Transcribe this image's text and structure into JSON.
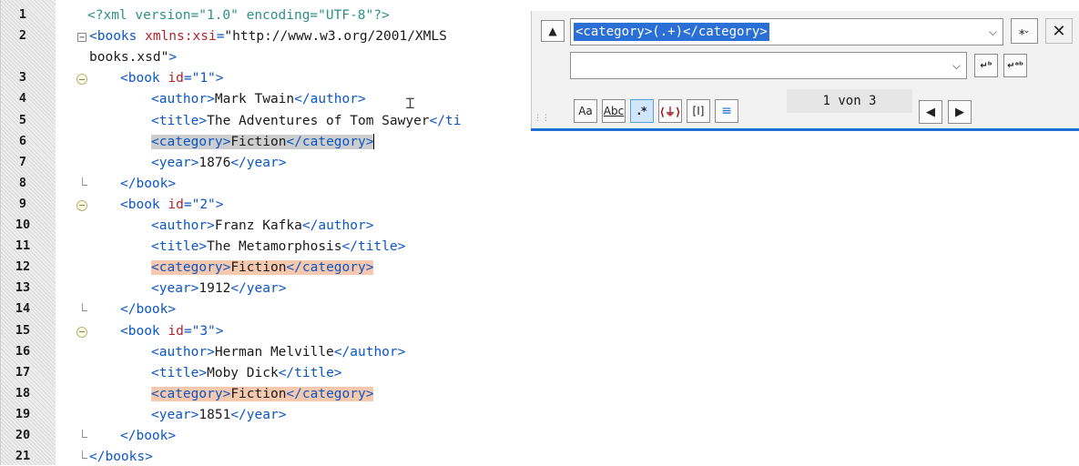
{
  "editor": {
    "lines": [
      {
        "num": "1",
        "parts": [
          [
            "decl",
            "<?xml version=\"1.0\" encoding=\"UTF-8\"?>"
          ]
        ]
      },
      {
        "num": "2",
        "parts": [
          [
            "tag",
            "<books "
          ],
          [
            "attr",
            "xmlns:xsi"
          ],
          [
            "tag",
            "="
          ],
          [
            "txt",
            "\"http://www.w3.org/2001/XMLS"
          ]
        ]
      },
      {
        "num": "",
        "parts": [
          [
            "txt",
            "books.xsd\""
          ],
          [
            "tag",
            ">"
          ]
        ]
      },
      {
        "num": "3",
        "parts": [
          [
            "tag",
            "<book "
          ],
          [
            "attr",
            "id"
          ],
          [
            "tag",
            "="
          ],
          [
            "val",
            "\"1\""
          ],
          [
            "tag",
            ">"
          ]
        ]
      },
      {
        "num": "4",
        "parts": [
          [
            "tag",
            "<author>"
          ],
          [
            "txt",
            "Mark Twain"
          ],
          [
            "tag",
            "</author>"
          ]
        ]
      },
      {
        "num": "5",
        "parts": [
          [
            "tag",
            "<title>"
          ],
          [
            "txt",
            "The Adventures of Tom Sawyer"
          ],
          [
            "tag",
            "</ti"
          ]
        ]
      },
      {
        "num": "6",
        "parts": [
          [
            "tag",
            "<category>"
          ],
          [
            "txt",
            "Fiction"
          ],
          [
            "tag",
            "</category>"
          ]
        ],
        "hl": "current"
      },
      {
        "num": "7",
        "parts": [
          [
            "tag",
            "<year>"
          ],
          [
            "txt",
            "1876"
          ],
          [
            "tag",
            "</year>"
          ]
        ]
      },
      {
        "num": "8",
        "parts": [
          [
            "tag",
            "</book>"
          ]
        ]
      },
      {
        "num": "9",
        "parts": [
          [
            "tag",
            "<book "
          ],
          [
            "attr",
            "id"
          ],
          [
            "tag",
            "="
          ],
          [
            "val",
            "\"2\""
          ],
          [
            "tag",
            ">"
          ]
        ]
      },
      {
        "num": "10",
        "parts": [
          [
            "tag",
            "<author>"
          ],
          [
            "txt",
            "Franz Kafka"
          ],
          [
            "tag",
            "</author>"
          ]
        ]
      },
      {
        "num": "11",
        "parts": [
          [
            "tag",
            "<title>"
          ],
          [
            "txt",
            "The Metamorphosis"
          ],
          [
            "tag",
            "</title>"
          ]
        ]
      },
      {
        "num": "12",
        "parts": [
          [
            "tag",
            "<category>"
          ],
          [
            "txt",
            "Fiction"
          ],
          [
            "tag",
            "</category>"
          ]
        ],
        "hl": "match"
      },
      {
        "num": "13",
        "parts": [
          [
            "tag",
            "<year>"
          ],
          [
            "txt",
            "1912"
          ],
          [
            "tag",
            "</year>"
          ]
        ]
      },
      {
        "num": "14",
        "parts": [
          [
            "tag",
            "</book>"
          ]
        ]
      },
      {
        "num": "15",
        "parts": [
          [
            "tag",
            "<book "
          ],
          [
            "attr",
            "id"
          ],
          [
            "tag",
            "="
          ],
          [
            "val",
            "\"3\""
          ],
          [
            "tag",
            ">"
          ]
        ]
      },
      {
        "num": "16",
        "parts": [
          [
            "tag",
            "<author>"
          ],
          [
            "txt",
            "Herman Melville"
          ],
          [
            "tag",
            "</author>"
          ]
        ]
      },
      {
        "num": "17",
        "parts": [
          [
            "tag",
            "<title>"
          ],
          [
            "txt",
            "Moby Dick"
          ],
          [
            "tag",
            "</title>"
          ]
        ]
      },
      {
        "num": "18",
        "parts": [
          [
            "tag",
            "<category>"
          ],
          [
            "txt",
            "Fiction"
          ],
          [
            "tag",
            "</category>"
          ]
        ],
        "hl": "match"
      },
      {
        "num": "19",
        "parts": [
          [
            "tag",
            "<year>"
          ],
          [
            "txt",
            "1851"
          ],
          [
            "tag",
            "</year>"
          ]
        ]
      },
      {
        "num": "20",
        "parts": [
          [
            "tag",
            "</book>"
          ]
        ]
      },
      {
        "num": "21",
        "parts": [
          [
            "tag",
            "</books>"
          ]
        ]
      }
    ]
  },
  "find": {
    "search_value": "<category>(.+)</category>",
    "replace_value": "",
    "counter": "1 von 3",
    "options": [
      "match-case",
      "whole-word",
      "regex",
      "xpath",
      "selection",
      "format"
    ]
  },
  "colors": {
    "tag": "#0a56c6",
    "attr": "#b0242c",
    "decl": "#2f8f88",
    "accent": "#1d6fd3",
    "current_highlight": "#cdcdcd",
    "match_highlight": "#f6c8ae"
  }
}
